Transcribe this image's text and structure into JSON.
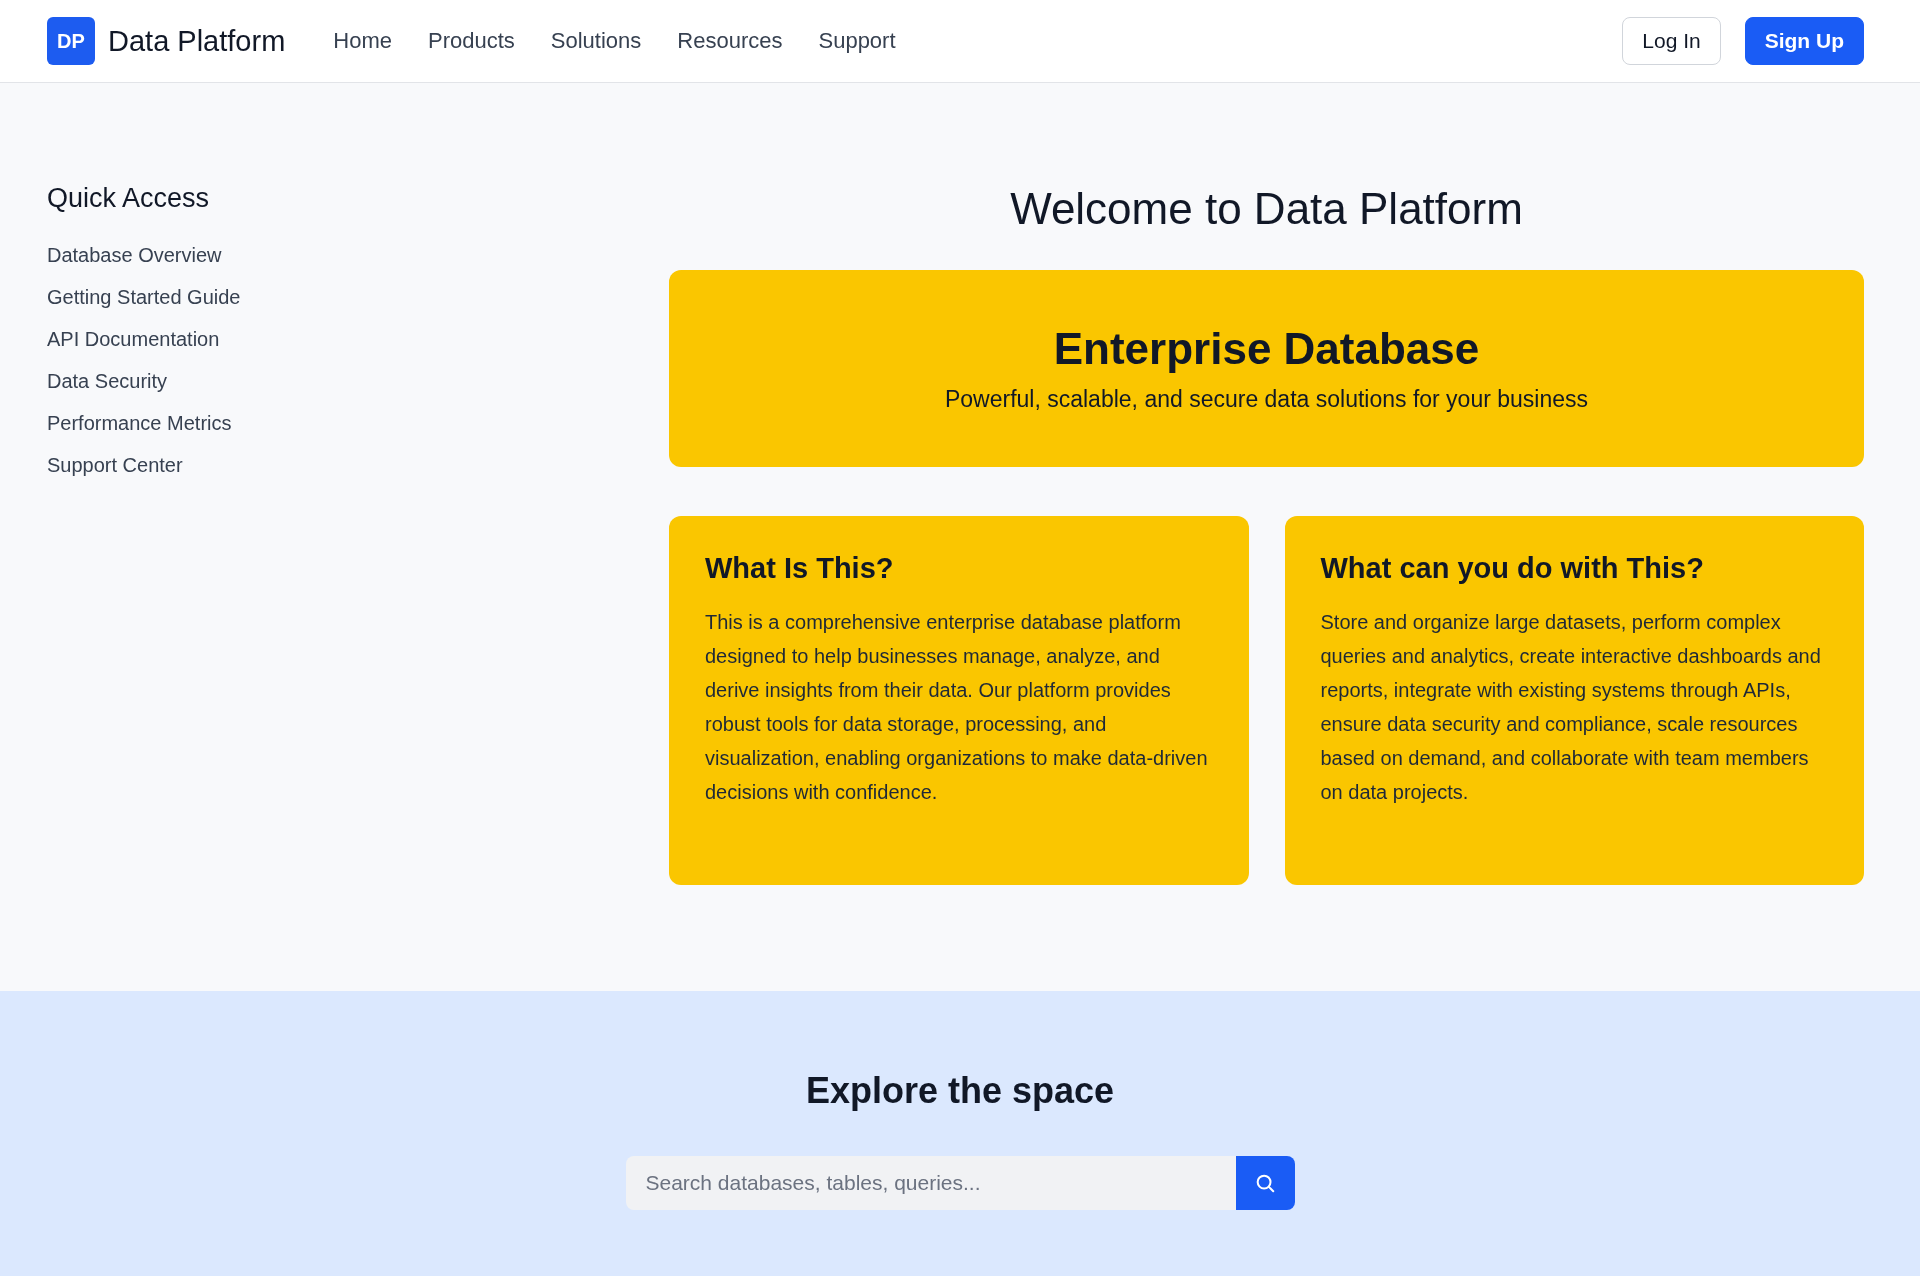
{
  "header": {
    "logo_mark": "DP",
    "brand": "Data Platform",
    "nav": [
      "Home",
      "Products",
      "Solutions",
      "Resources",
      "Support"
    ],
    "buttons": [
      {
        "label": "Log In",
        "kind": "outline"
      },
      {
        "label": "Sign Up",
        "kind": "primary"
      }
    ]
  },
  "sidebar": {
    "title": "Quick Access",
    "items": [
      "Database Overview",
      "Getting Started Guide",
      "API Documentation",
      "Data Security",
      "Performance Metrics",
      "Support Center"
    ]
  },
  "main": {
    "title": "Welcome to Data Platform",
    "hero": {
      "title": "Enterprise Database",
      "subtitle": "Powerful, scalable, and secure data solutions for your business"
    },
    "cards": [
      {
        "title": "What Is This?",
        "body": "This is a comprehensive enterprise database platform designed to help businesses manage, analyze, and derive insights from their data. Our platform provides robust tools for data storage, processing, and visualization, enabling organizations to make data-driven decisions with confidence."
      },
      {
        "title": "What can you do with This?",
        "body": "Store and organize large datasets, perform complex queries and analytics, create interactive dashboards and reports, integrate with existing systems through APIs, ensure data security and compliance, scale resources based on demand, and collaborate with team members on data projects."
      }
    ]
  },
  "explore": {
    "title": "Explore the space",
    "search": {
      "placeholder": "Search databases, tables, queries..."
    }
  }
}
